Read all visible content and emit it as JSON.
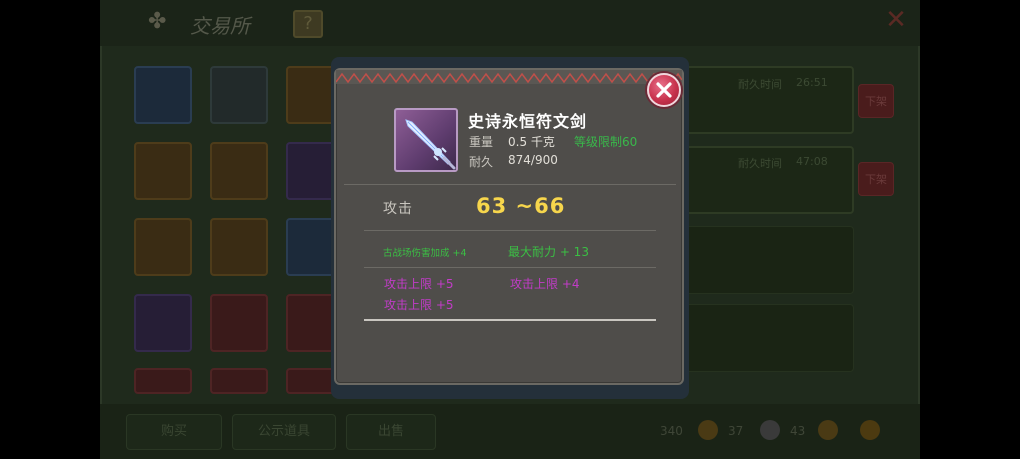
{
  "background": {
    "title": "交易所",
    "help": "?",
    "rows": [
      {
        "label": "耐久时间",
        "value": "26:51",
        "button": "下架"
      },
      {
        "label": "耐久时间",
        "value": "47:08",
        "button": "下架"
      }
    ],
    "tabs": [
      "购买",
      "公示道具",
      "出售"
    ],
    "currency": [
      "340",
      "37",
      "43"
    ]
  },
  "tooltip": {
    "item_name": "史诗永恒符文剑",
    "weight_label": "重量",
    "weight_value": "0.5 千克",
    "level_req": "等级限制60",
    "durability_label": "耐久",
    "durability_value": "874/900",
    "attack_label": "攻击",
    "attack_value": "63 ~66",
    "bonus_small": "古战场伤害加成 +4",
    "bonus_durability": "最大耐力 + 13",
    "purple_lines": [
      "攻击上限 +5",
      "攻击上限 +4",
      "攻击上限 +5"
    ]
  },
  "colors": {
    "attack_value": "#f7d64c",
    "green_stat": "#3bbf44",
    "purple_stat": "#c23cc8",
    "close_button": "#c8334e"
  },
  "icons": {
    "item": "runic-sword-icon",
    "close": "close-x-icon",
    "title": "exchange-emblem-icon"
  }
}
